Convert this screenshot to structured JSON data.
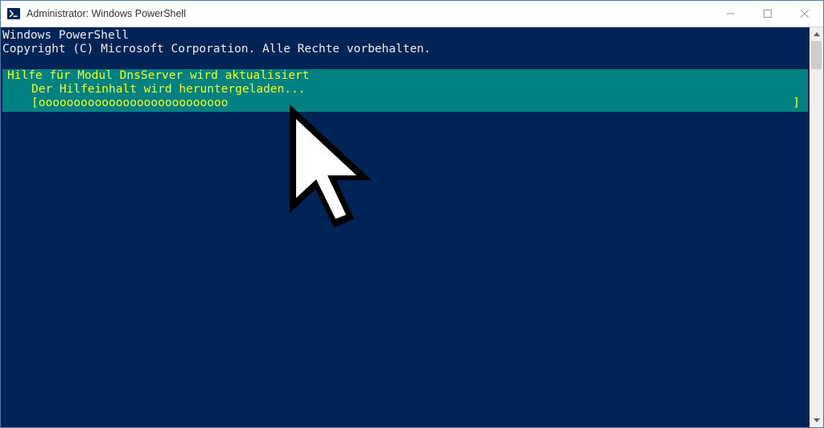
{
  "titlebar": {
    "title": "Administrator: Windows PowerShell"
  },
  "console": {
    "header1": "Windows PowerShell",
    "header2": "Copyright (C) Microsoft Corporation. Alle Rechte vorbehalten.",
    "progress": {
      "title": "Hilfe für Modul DnsServer wird aktualisiert",
      "status": "Der Hilfeinhalt wird heruntergeladen...",
      "bar_open": "[",
      "bar_fill": "ooooooooooooooooooooooooooo",
      "bar_close": "]"
    }
  },
  "colors": {
    "console_bg": "#012456",
    "progress_bg": "#008080",
    "progress_fg": "#f8ff1a",
    "text_white": "#eeedf0"
  }
}
